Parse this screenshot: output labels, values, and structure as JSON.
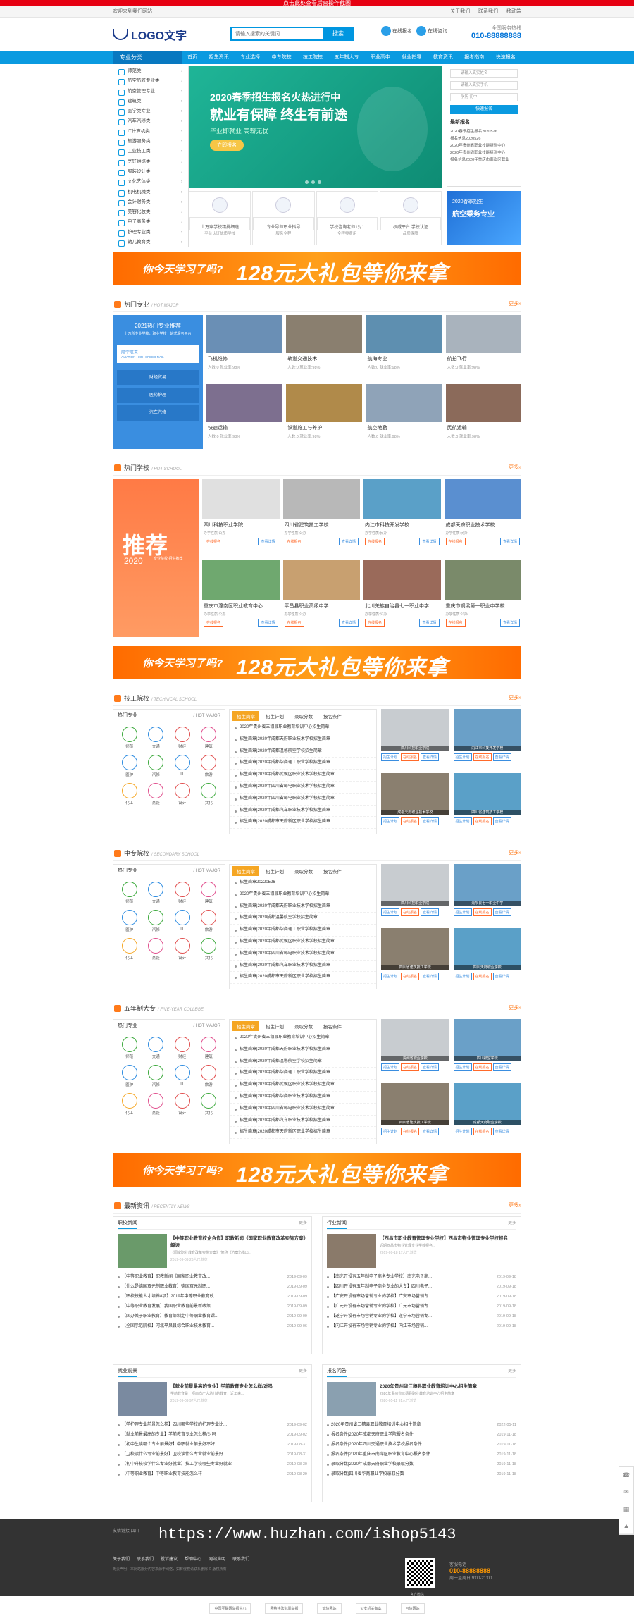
{
  "topred": "点击此处查看后台操作截图",
  "topbar": {
    "left": "欢迎来到我们网站",
    "r1": "关于我们",
    "r2": "联系我们",
    "r3": "移动端"
  },
  "logo": "LOGO文字",
  "search": {
    "placeholder": "请输入搜索的关键词",
    "button": "搜索"
  },
  "hicons": {
    "a": "在线报名",
    "b": "在线咨询"
  },
  "tel": {
    "label": "全国服务热线",
    "number": "010-88888888"
  },
  "nav": {
    "cat": "专业分类",
    "items": [
      "首页",
      "招生资讯",
      "专业选择",
      "中专院校",
      "技工院校",
      "五年制大专",
      "职业高中",
      "就业指导",
      "教育资讯",
      "报考指南",
      "快速报名"
    ]
  },
  "sidemenu": [
    "师范类",
    "航空航铁专业类",
    "航空管理专业",
    "建筑类",
    "医学类专业",
    "汽车汽修类",
    "IT计算机类",
    "旅游服务类",
    "工业技工类",
    "烹饪烘焙类",
    "服装设计类",
    "文化艺体类",
    "机电机械类",
    "会计财务类",
    "美容化妆类",
    "电子商务类",
    "护理专业类",
    "幼儿教育类"
  ],
  "banner": {
    "t1": "2020春季招生报名火热进行中",
    "t2": "就业有保障 终生有前途",
    "t3": "毕业即就业 高薪无忧",
    "t4": "立即报名"
  },
  "features": [
    {
      "t": "上万家学校精挑细选",
      "s": "平台认证优质学校"
    },
    {
      "t": "专业导师职业指导",
      "s": "服务全程"
    },
    {
      "t": "学校咨询老师1对1",
      "s": "全程零费用"
    },
    {
      "t": "权威平台 学校认证",
      "s": "品质保障"
    }
  ],
  "login": {
    "f1": "请输入真实姓名",
    "f2": "请输入真实手机",
    "f3": "学历 初中",
    "btn": "快速报名",
    "news_title": "最新报名",
    "news": [
      "2020春季招生报名2020526",
      "报名信息2020526",
      "2020年贵州省职业技能培训中心",
      "2020年贵州省职业技能培训中心",
      "报名信息2020年重庆市南岸区职业"
    ]
  },
  "ad1": {
    "a": "2020春季招生",
    "b": "航空乘务专业"
  },
  "promo": {
    "a": "你今天学习了吗?",
    "b": "128元大礼包等你来拿"
  },
  "hotmajor": {
    "title": "热门专业",
    "en": "/ HOT MAJOR",
    "more": "更多»",
    "left_t": "2021热门专业推荐",
    "left_s": "上万所专业学校，职业学校一站式服务平台",
    "sub": "航空航天",
    "sub_en": "AVIATION HIGH SPEED RAIL",
    "blocks": [
      "财经贸易",
      "医药护理",
      "汽车汽修"
    ],
    "cards": [
      {
        "n": "飞机维修",
        "e": "人数:0  就业率:98%"
      },
      {
        "n": "轨道交通技术",
        "e": "人数:0  就业率:98%"
      },
      {
        "n": "航海专业",
        "e": "人数:0  就业率:98%"
      },
      {
        "n": "航拍飞行",
        "e": "人数:0  就业率:98%"
      },
      {
        "n": "快速运输",
        "e": "人数:0  就业率:98%"
      },
      {
        "n": "铁道施工与养护",
        "e": "人数:0  就业率:98%"
      },
      {
        "n": "航空地勤",
        "e": "人数:0  就业率:98%"
      },
      {
        "n": "民航运输",
        "e": "人数:0  就业率:98%"
      }
    ]
  },
  "hotschool": {
    "title": "热门学校",
    "en": "/ HOT SCHOOL",
    "more": "更多»",
    "big": "推荐",
    "yr": "2020",
    "sm": "专业院校 招生推荐",
    "cards": [
      {
        "n": "四川科技职业学院",
        "e": "办学性质:公办",
        "b": "在线报名",
        "c": "查看详情"
      },
      {
        "n": "四川省建筑技工学校",
        "e": "办学性质:公办",
        "b": "在线报名",
        "c": "查看详情"
      },
      {
        "n": "内江市科技开发学校",
        "e": "办学性质:民办",
        "b": "在线报名",
        "c": "查看详情"
      },
      {
        "n": "成都天府职业技术学校",
        "e": "办学性质:民办",
        "b": "在线报名",
        "c": "查看详情"
      },
      {
        "n": "重庆市潼南区职业教育中心",
        "e": "办学性质:公办",
        "b": "在线报名",
        "c": "查看详情"
      },
      {
        "n": "平昌县职业高级中学",
        "e": "办学性质:公办",
        "b": "在线报名",
        "c": "查看详情"
      },
      {
        "n": "北川羌族自治县七一职业中学",
        "e": "办学性质:公办",
        "b": "在线报名",
        "c": "查看详情"
      },
      {
        "n": "重庆市铜梁第一职业中学校",
        "e": "办学性质:公办",
        "b": "在线报名",
        "c": "查看详情"
      }
    ]
  },
  "major_grid": [
    "师范",
    "交通",
    "财经",
    "建筑",
    "医护",
    "汽修",
    "IT",
    "旅游",
    "化工",
    "烹饪",
    "设计",
    "文化"
  ],
  "sec_tech": {
    "title": "技工院校",
    "en": "/ TECHNICAL SCHOOL",
    "more": "更多»",
    "tabs": [
      "招生简章",
      "招生计划",
      "录取分数",
      "报名条件"
    ],
    "list": [
      "2020年贵州省三穗县职业教育培训中心招生简章",
      "招生简章|2020年成都天府职业技术学校招生简章",
      "招生简章|2020年成都温馨航空学校招生简章",
      "招生简章|2020年成都华商理工职业学校招生简章",
      "招生简章|2020年成都武侯区职业技术学校招生简章",
      "招生简章|2020年四川省邮电职业技术学校招生简章",
      "招生简章|2020年四川省邮电职业技术学校招生简章",
      "招生简章|2020年成都汽车职业技术学校招生简章",
      "招生简章|2020成都市天府新区职业学校招生简章"
    ],
    "imgs": [
      "四川科技职业学院",
      "内江市科技开发学校",
      "成都天府职业技术学校",
      "四川省建筑技工学校"
    ]
  },
  "sec_mid": {
    "title": "中专院校",
    "en": "/ SECONDARY SCHOOL",
    "more": "更多»",
    "tabs": [
      "招生简章",
      "招生计划",
      "录取分数",
      "报名条件"
    ],
    "list": [
      "招生简章20220526",
      "2020年贵州省三穗县职业教育培训中心招生简章",
      "招生简章|2020年成都天府职业技术学校招生简章",
      "招生简章|2020成都温馨航空学校招生简章",
      "招生简章|2020年成都华商理工职业学校招生简章",
      "招生简章|2020年成都武侯区职业技术学校招生简章",
      "招生简章|2020年四川省邮电职业技术学校招生简章",
      "招生简章|2020年成都汽车职业技术学校招生简章",
      "招生简章|2020成都市天府新区职业学校招生简章"
    ],
    "imgs": [
      "四川科技职业学院",
      "元坝县七一职业中学",
      "四川省建筑技工学校",
      "四川天府职业学校"
    ]
  },
  "sec_five": {
    "title": "五年制大专",
    "en": "/ FIVE-YEAR COLLEGE",
    "more": "更多»",
    "tabs": [
      "招生简章",
      "招生计划",
      "录取分数",
      "报名条件"
    ],
    "list": [
      "2020年贵州省三穗县职业教育培训中心招生简章",
      "招生简章|2020年成都天府职业技术学校招生简章",
      "招生简章|2020年成都温馨航空学校招生简章",
      "招生简章|2020年成都华商理工职业学校招生简章",
      "招生简章|2020年成都武侯区职业技术学校招生简章",
      "招生简章|2020年成都华商职业技术学校招生简章",
      "招生简章|2020年四川省邮电职业技术学校招生简章",
      "招生简章|2020年成都汽车职业技术学校招生简章",
      "招生简章|2020成都市天府新区职业学校招生简章"
    ],
    "imgs": [
      "贵州省职业学校",
      "四川航空学校",
      "四川省建筑技工学校",
      "成都天府职业学校"
    ]
  },
  "promo2": {
    "a": "你今天学习了吗?",
    "b": "128元大礼包等你来拿"
  },
  "promo3": {
    "a": "你今天学习了吗?",
    "b": "128元大礼包等你来拿"
  },
  "newsec": {
    "title": "最新资讯",
    "en": "/ RECENTLY NEWS",
    "more": "更多»"
  },
  "news": [
    {
      "hd": "职校新闻",
      "more": "更多",
      "tt": "【中等职业教育校企合作】职教新闻《国家职业教育改革实施方案》解读",
      "tp": "《国家职业教育改革实施方案》(简称《方案》)指出...",
      "td": "2019-09-09",
      "tv": "26人已浏览",
      "items": [
        [
          "【中等职业教育】职教新闻《国家职业教育改...",
          "2019-09-09"
        ],
        [
          "【什么是德国双元制职业教育】德国双元制职...",
          "2019-09-09"
        ],
        [
          "【职校技能人才培养8项】2019年中等职业教育改...",
          "2019-09-09"
        ],
        [
          "【中等职业教育发展】我国职业教育前景新政策",
          "2019-09-09"
        ],
        [
          "【国办关于职业教育】教育部制定中等职业教育课...",
          "2019-09-09"
        ],
        [
          "【全国示范院校】河北平泉县综合职业技术教育...",
          "2019-09-06"
        ]
      ]
    },
    {
      "hd": "行业新闻",
      "more": "更多",
      "tt": "【西昌市职业教育管理专业学校】西昌市物业管理专业学校报名",
      "tp": "近期西昌市物业管理专业学校报名...",
      "td": "2019-09-18",
      "tv": "17人已浏览",
      "items": [
        [
          "【南充开设有五年制电子商务专业学校】南充电子商...",
          "2019-09-18"
        ],
        [
          "【四川开设有五年制电子商务专业的大专】四川电子...",
          "2019-09-18"
        ],
        [
          "【广安开设有市场营销专业的学校】广安市场营销专...",
          "2019-09-18"
        ],
        [
          "【广元开设有市场营销专业的学校】广元市场营销专...",
          "2019-09-18"
        ],
        [
          "【遂宁开设有市场营销专业的学校】遂宁市场营销专...",
          "2019-09-18"
        ],
        [
          "【内江开设有市场营销专业的学校】内江市场营销...",
          "2019-09-18"
        ]
      ]
    },
    {
      "hd": "就业前景",
      "more": "更多",
      "tt": "【就业前景最高的专业】学前教育专业怎么样/对吗",
      "tp": "学前教育是一项面向广大幼儿的教育，近年来...",
      "td": "2019-09-09",
      "tv": "97人已浏览",
      "items": [
        [
          "【学护理专业前景怎么样】四川哪些学校的护理专业比...",
          "2019-09-02"
        ],
        [
          "【就业前景最高的专业】学前教育专业怎么样/对吗",
          "2019-09-02"
        ],
        [
          "【初中生读哪个专业前景好】中职就业前景好不好",
          "2019-08-31"
        ],
        [
          "【卫校读什么专业前景好】卫校读什么专业就业前景好",
          "2019-08-31"
        ],
        [
          "【初中升技校学什么专业好就业】技工学校哪些专业好就业",
          "2019-08-30"
        ],
        [
          "【中等职业教育】中等职业教育技能怎么样",
          "2019-08-29"
        ]
      ]
    },
    {
      "hd": "报名问答",
      "more": "更多",
      "tt": "2020年贵州省三穗县职业教育培训中心招生简章",
      "tp": "2020年贵州省三穗县职业教育培训中心招生简章",
      "td": "2020-05-11",
      "tv": "91人已浏览",
      "items": [
        [
          "2020年贵州省三穗县职业教育培训中心招生简章",
          "2022-05-11"
        ],
        [
          "报名条件|2020年成都天府职业学院报名条件",
          "2019-11-18"
        ],
        [
          "报名条件|2020年四川交通职业技术学校报名条件",
          "2019-11-18"
        ],
        [
          "报名条件|2020年重庆市南岸区职业教育中心报名条件",
          "2019-11-18"
        ],
        [
          "录取分数|2020年成都天府职业学校录取分数",
          "2019-11-18"
        ],
        [
          "录取分数|四川省华商职业学校录取分数",
          "2019-11-18"
        ]
      ]
    }
  ],
  "footer": {
    "links": "友情链接  四川",
    "watermark": "https://www.huzhan.com/ishop5143",
    "fn": [
      "关于我们",
      "联系我们",
      "投诉建议",
      "帮助中心",
      "网站声明",
      "联系我们"
    ],
    "cp": "免责声明：本网站部分内容来源于网络，如有侵权请联系删除 © 版权所有",
    "qrcap": "官方微信",
    "ct_label": "客服电话",
    "ct": "010-88888888",
    "ct2": "周一至周日 9:00-21:00"
  },
  "bottomlinks": [
    "中国互联网举报中心",
    "网络违法犯罪举报",
    "诚信网站",
    "公安机关备案",
    "可信网站"
  ]
}
